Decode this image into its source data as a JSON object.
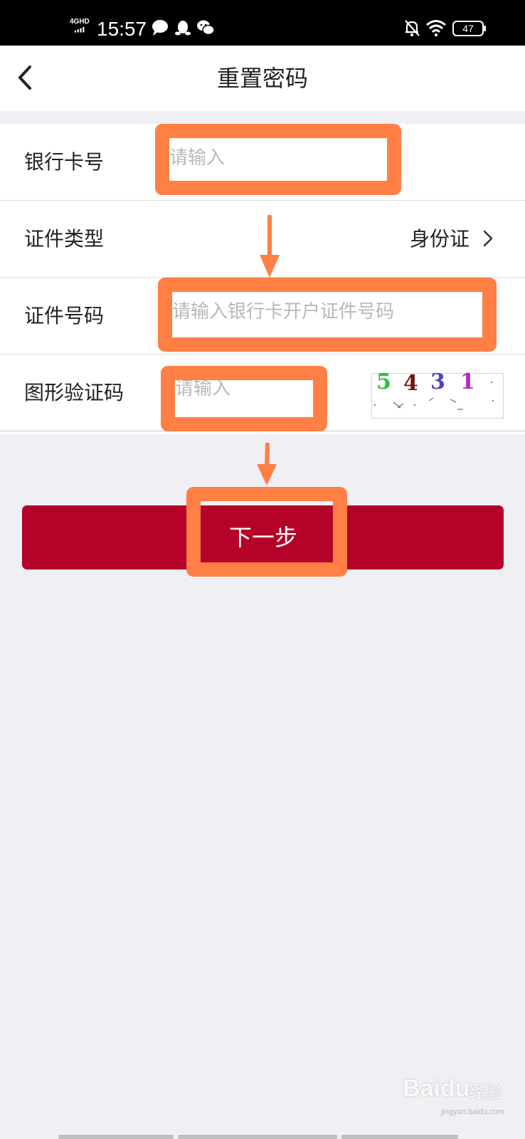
{
  "status_bar": {
    "network": "4GHD",
    "time": "15:57",
    "battery": "47",
    "icons": [
      "signal-icon",
      "chat-bubble-icon",
      "qq-penguin-icon",
      "wechat-icon",
      "bell-off-icon",
      "wifi-icon",
      "battery-icon"
    ]
  },
  "header": {
    "title": "重置密码",
    "back_icon": "chevron-left-icon"
  },
  "form": {
    "card_number": {
      "label": "银行卡号",
      "value": "",
      "placeholder": "请输入"
    },
    "id_type": {
      "label": "证件类型",
      "value": "身份证",
      "icon": "chevron-right-icon"
    },
    "id_number": {
      "label": "证件号码",
      "value": "",
      "placeholder": "请输入银行卡开户证件号码"
    },
    "captcha": {
      "label": "图形验证码",
      "value": "",
      "placeholder": "请输入",
      "image_digits": [
        "5",
        "4",
        "3",
        "1"
      ]
    }
  },
  "next_button": {
    "label": "下一步"
  },
  "annotation": {
    "highlight_color": "#ff7f45"
  },
  "watermark": {
    "brand": "Baidu",
    "brand_cn": "经验",
    "url": "jingyan.baidu.com"
  },
  "colors": {
    "primary": "#b50229",
    "background": "#efeff4",
    "placeholder": "#b8b8b8"
  }
}
